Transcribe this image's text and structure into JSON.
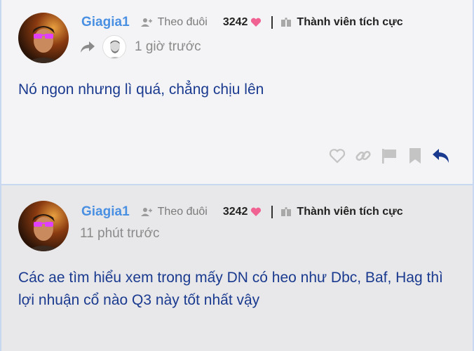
{
  "posts": [
    {
      "username": "Giagia1",
      "follow_label": "Theo đuôi",
      "points": "3242",
      "rank": "Thành viên tích cực",
      "time": "1 giờ trước",
      "content": "Nó ngon nhưng lì quá, chẳng chịu lên",
      "is_reply": true,
      "actions": [
        "heart-icon",
        "link-icon",
        "flag-icon",
        "bookmark-icon",
        "reply-icon"
      ]
    },
    {
      "username": "Giagia1",
      "follow_label": "Theo đuôi",
      "points": "3242",
      "rank": "Thành viên tích cực",
      "time": "11 phút trước",
      "content": "Các ae tìm hiểu xem trong mấy DN có heo như Dbc, Baf, Hag thì lợi nhuận cổ nào Q3 này tốt nhất vậy",
      "is_reply": false
    }
  ],
  "colors": {
    "username": "#4a90e2",
    "content": "#1a3a8f",
    "heart": "#f06292",
    "reply_action": "#1a3a8f",
    "muted_icon": "#c4c4c4"
  }
}
